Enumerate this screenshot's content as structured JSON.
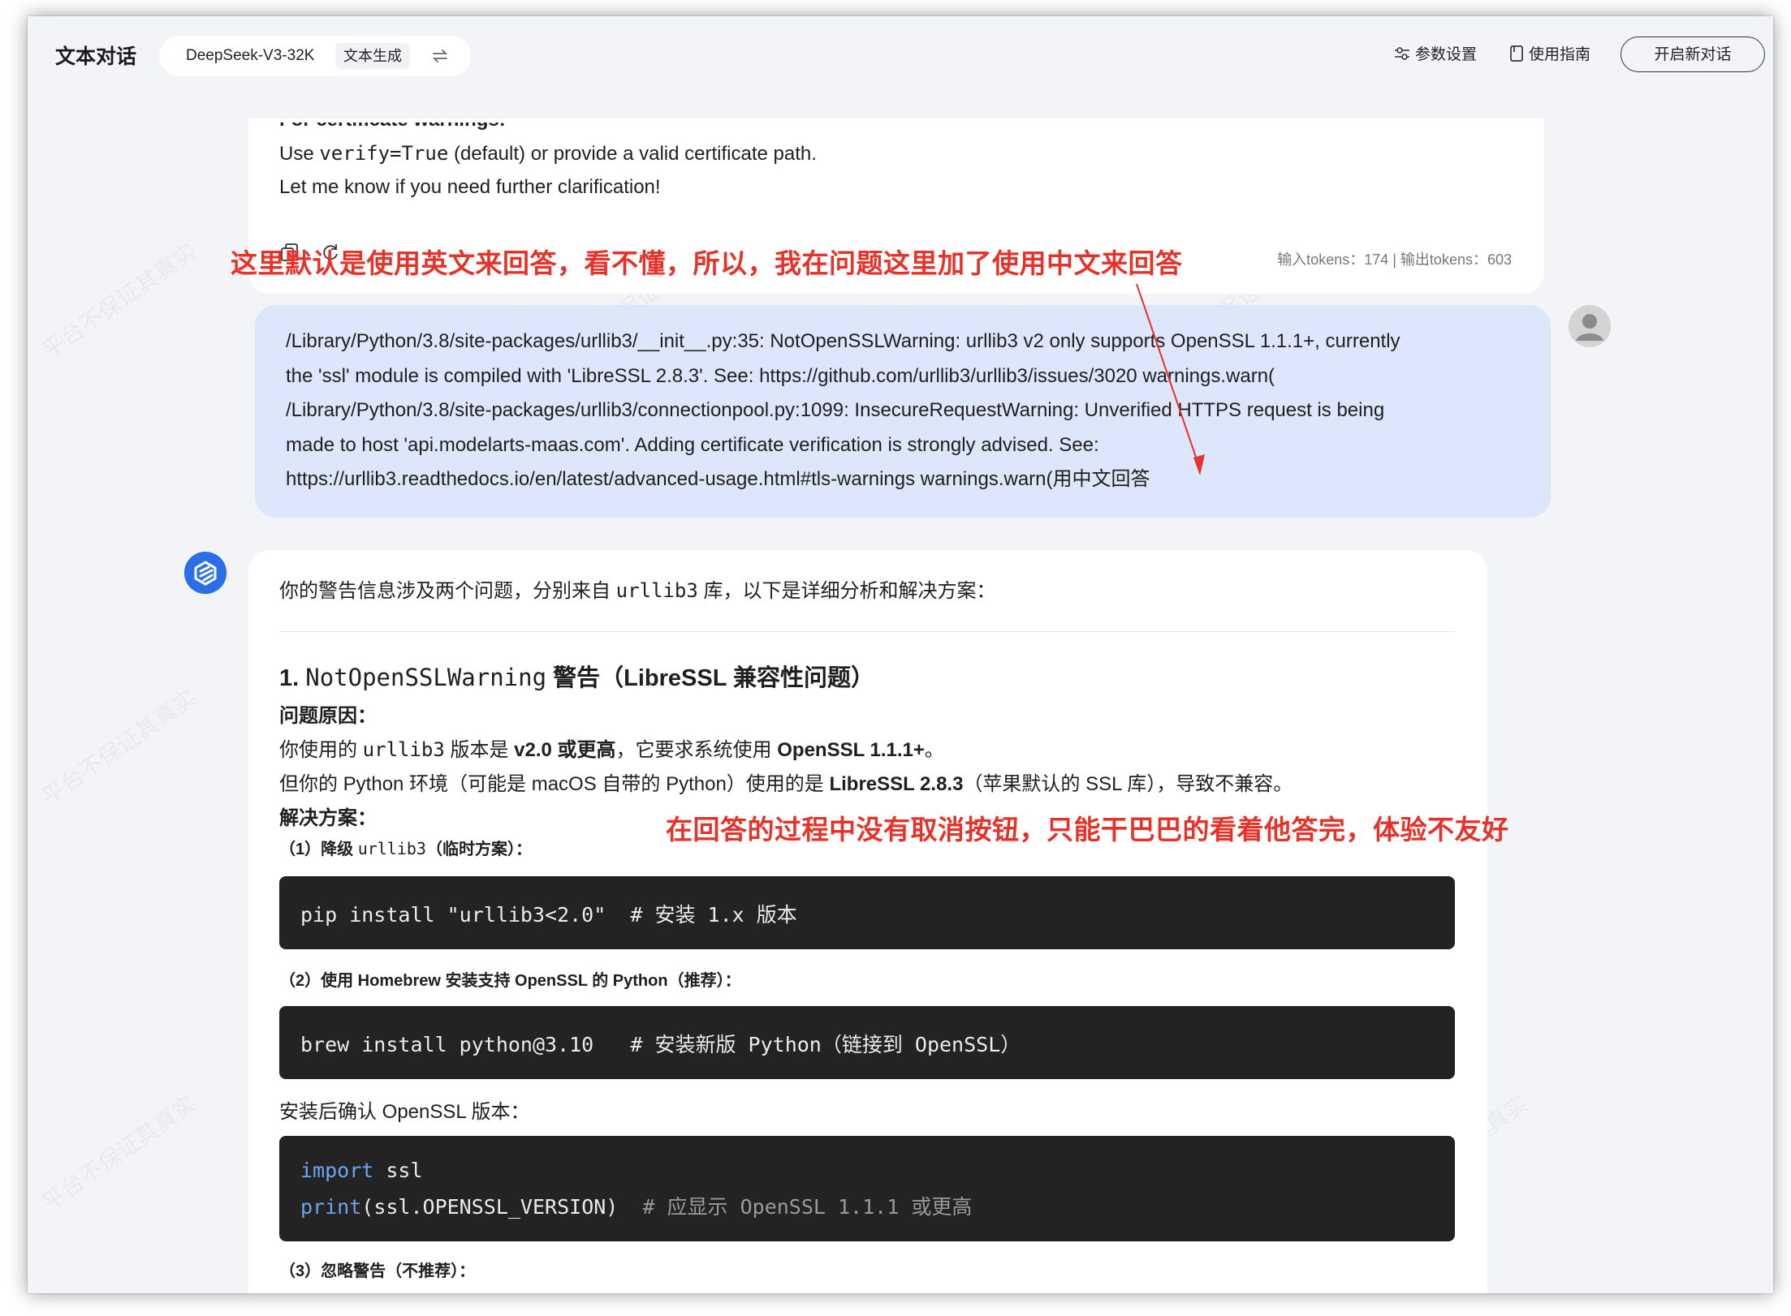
{
  "header": {
    "title": "文本对话",
    "model": "DeepSeek-V3-32K",
    "mode": "文本生成",
    "params_label": "参数设置",
    "guide_label": "使用指南",
    "new_chat_label": "开启新对话"
  },
  "prev_answer": {
    "cut_line": "For certificate warnings:",
    "line1_pre": "Use ",
    "line1_code": "verify=True",
    "line1_post": " (default) or provide a valid certificate path.",
    "line2": "Let me know if you need further clarification!",
    "tokens": "输入tokens：174 | 输出tokens：603"
  },
  "user_message": {
    "lines": [
      "/Library/Python/3.8/site-packages/urllib3/__init__.py:35: NotOpenSSLWarning: urllib3 v2 only supports OpenSSL 1.1.1+, currently",
      "the 'ssl' module is compiled with 'LibreSSL 2.8.3'. See: https://github.com/urllib3/urllib3/issues/3020 warnings.warn(",
      "/Library/Python/3.8/site-packages/urllib3/connectionpool.py:1099: InsecureRequestWarning: Unverified HTTPS request is being",
      "made to host 'api.modelarts-maas.com'. Adding certificate verification is strongly advised. See:",
      "https://urllib3.readthedocs.io/en/latest/advanced-usage.html#tls-warnings warnings.warn(用中文回答"
    ]
  },
  "answer": {
    "intro_pre": "你的警告信息涉及两个问题，分别来自 ",
    "intro_code": "urllib3",
    "intro_post": " 库，以下是详细分析和解决方案：",
    "h1_num": "1. ",
    "h1_code": "NotOpenSSLWarning",
    "h1_post": " 警告（LibreSSL 兼容性问题）",
    "cause_label": "问题原因：",
    "cause1_pre": "你使用的 ",
    "cause1_code": "urllib3",
    "cause1_mid": " 版本是 ",
    "cause1_b1": "v2.0 或更高",
    "cause1_mid2": "，它要求系统使用 ",
    "cause1_b2": "OpenSSL 1.1.1+",
    "cause1_post": "。",
    "cause2_pre": "但你的 Python 环境（可能是 macOS 自带的 Python）使用的是 ",
    "cause2_b": "LibreSSL 2.8.3",
    "cause2_post": "（苹果默认的 SSL 库），导致不兼容。",
    "solution_label": "解决方案：",
    "step1_pre": "（1）降级 ",
    "step1_code": "urllib3",
    "step1_post": "（临时方案）：",
    "code1": "pip install \"urllib3<2.0\"  # 安装 1.x 版本",
    "step2": "（2）使用 Homebrew 安装支持 OpenSSL 的 Python（推荐）：",
    "code2": "brew install python@3.10   # 安装新版 Python（链接到 OpenSSL）",
    "after_install": "安装后确认 OpenSSL 版本：",
    "code3_l1_kw": "import",
    "code3_l1_rest": " ssl",
    "code3_l2_kw": "print",
    "code3_l2_rest": "(ssl.OPENSSL_VERSION)",
    "code3_l2_comment": "  # 应显示 OpenSSL 1.1.1 或更高",
    "step3": "（3）忽略警告（不推荐）："
  },
  "annotations": {
    "note1": "这里默认是使用英文来回答，看不懂，所以，我在问题这里加了使用中文来回答",
    "note2": "在回答的过程中没有取消按钮，只能干巴巴的看着他答完，体验不友好"
  },
  "colors": {
    "annotation": "#e63228",
    "user_bubble": "#dde6fb",
    "ai_avatar": "#2a6ee8",
    "code_bg": "#232323"
  }
}
